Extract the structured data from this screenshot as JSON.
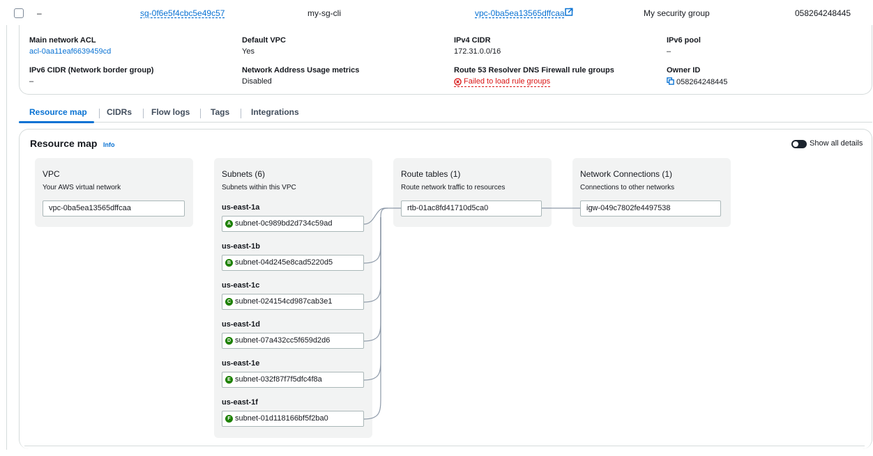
{
  "row": {
    "dash": "–",
    "sg_id": "sg-0f6e5f4cbc5e49c57",
    "name": "my-sg-cli",
    "vpc_id": "vpc-0ba5ea13565dffcaa",
    "description": "My security group",
    "owner": "058264248445"
  },
  "details": {
    "main_acl_label": "Main network ACL",
    "main_acl_value": "acl-0aa11eaf6639459cd",
    "default_vpc_label": "Default VPC",
    "default_vpc_value": "Yes",
    "ipv4_label": "IPv4 CIDR",
    "ipv4_value": "172.31.0.0/16",
    "ipv6_pool_label": "IPv6 pool",
    "ipv6_pool_value": "–",
    "ipv6_cidr_label": "IPv6 CIDR (Network border group)",
    "ipv6_cidr_value": "–",
    "nau_label": "Network Address Usage metrics",
    "nau_value": "Disabled",
    "r53_label": "Route 53 Resolver DNS Firewall rule groups",
    "r53_value": "Failed to load rule groups",
    "owner_label": "Owner ID",
    "owner_value": "058264248445"
  },
  "tabs": [
    "Resource map",
    "CIDRs",
    "Flow logs",
    "Tags",
    "Integrations"
  ],
  "resource_map": {
    "title": "Resource map",
    "info": "Info",
    "toggle_label": "Show all details",
    "vpc": {
      "title": "VPC",
      "subtitle": "Your AWS virtual network",
      "node": "vpc-0ba5ea13565dffcaa"
    },
    "subnets": {
      "title": "Subnets (6)",
      "subtitle": "Subnets within this VPC",
      "zones": [
        {
          "az": "us-east-1a",
          "badge": "A",
          "subnet": "subnet-0c989bd2d734c59ad"
        },
        {
          "az": "us-east-1b",
          "badge": "B",
          "subnet": "subnet-04d245e8cad5220d5"
        },
        {
          "az": "us-east-1c",
          "badge": "C",
          "subnet": "subnet-024154cd987cab3e1"
        },
        {
          "az": "us-east-1d",
          "badge": "D",
          "subnet": "subnet-07a432cc5f659d2d6"
        },
        {
          "az": "us-east-1e",
          "badge": "E",
          "subnet": "subnet-032f87f7f5dfc4f8a"
        },
        {
          "az": "us-east-1f",
          "badge": "F",
          "subnet": "subnet-01d118166bf5f2ba0"
        }
      ]
    },
    "route_tables": {
      "title": "Route tables (1)",
      "subtitle": "Route network traffic to resources",
      "node": "rtb-01ac8fd41710d5ca0"
    },
    "network_connections": {
      "title": "Network Connections (1)",
      "subtitle": "Connections to other networks",
      "node": "igw-049c7802fe4497538"
    }
  },
  "colors": {
    "link": "#0972d3",
    "error": "#d91515",
    "badge": "#1d8102"
  }
}
